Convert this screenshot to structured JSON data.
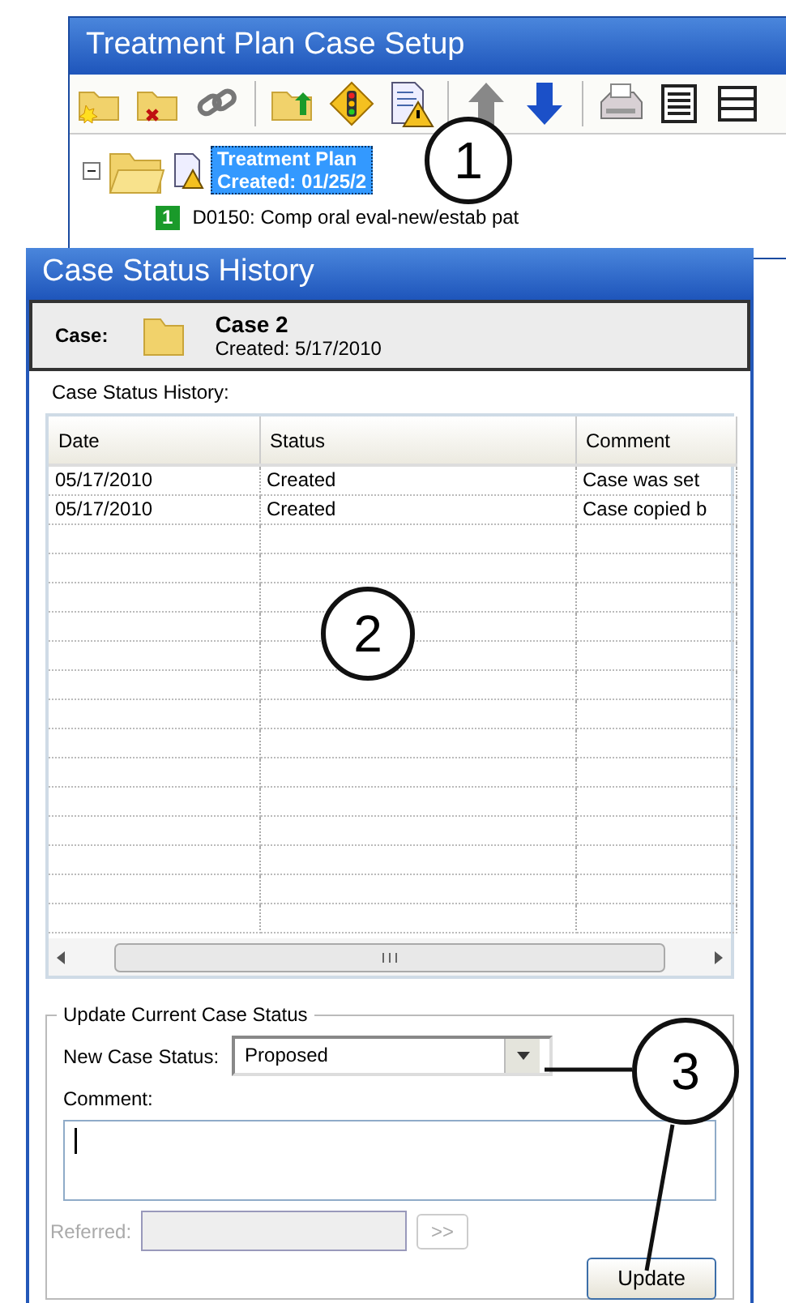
{
  "back_window": {
    "title": "Treatment Plan Case Setup",
    "tree": {
      "expanded": true,
      "selected": true,
      "label_lines": [
        "Treatment Plan",
        "Created: 01/25/2"
      ],
      "children": [
        {
          "badge": "1",
          "label": "D0150: Comp oral eval-new/estab pat"
        }
      ]
    }
  },
  "dialog": {
    "title": "Case Status History",
    "case": {
      "label": "Case:",
      "name": "Case 2",
      "created": "Created: 5/17/2010"
    },
    "history_label": "Case Status History:",
    "table": {
      "columns": [
        "Date",
        "Status",
        "Comment"
      ],
      "rows": [
        [
          "05/17/2010",
          "Created",
          "Case was set"
        ],
        [
          "05/17/2010",
          "Created",
          "Case copied b"
        ]
      ]
    },
    "update_group": {
      "legend": "Update Current Case Status",
      "status_label": "New Case Status:",
      "status_value": "Proposed",
      "comment_label": "Comment:",
      "referred_label": "Referred:",
      "referred_disabled": true,
      "browse_button": ">>",
      "update_button": "Update"
    }
  },
  "callouts": [
    "1",
    "2",
    "3"
  ]
}
